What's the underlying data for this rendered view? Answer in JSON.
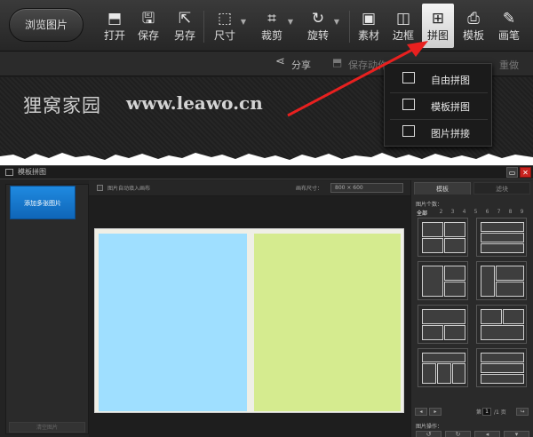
{
  "toolbar": {
    "browse_label": "浏览图片",
    "buttons": [
      {
        "label": "打开",
        "icon": "open-icon"
      },
      {
        "label": "保存",
        "icon": "save-icon"
      },
      {
        "label": "另存",
        "icon": "save-as-icon"
      },
      {
        "label": "尺寸",
        "icon": "resize-icon"
      },
      {
        "label": "裁剪",
        "icon": "crop-icon"
      },
      {
        "label": "旋转",
        "icon": "rotate-icon"
      },
      {
        "label": "素材",
        "icon": "material-icon"
      },
      {
        "label": "边框",
        "icon": "frame-icon"
      },
      {
        "label": "拼图",
        "icon": "collage-icon"
      },
      {
        "label": "模板",
        "icon": "template-icon"
      },
      {
        "label": "画笔",
        "icon": "brush-icon"
      }
    ],
    "active": "拼图"
  },
  "row2": {
    "share": "分享",
    "save_action": "保存动作",
    "redo": "重做"
  },
  "watermark": {
    "cn": "狸窝家园",
    "url": "www.leawo.cn"
  },
  "dropdown": {
    "items": [
      "自由拼图",
      "模板拼图",
      "图片拼接"
    ]
  },
  "window": {
    "title": "模板拼图",
    "add_button": "添加多张图片",
    "clear_button": "清空图片",
    "auto_fill_label": "图片自动填入画布",
    "canvas_size_label": "画布尺寸：",
    "canvas_size_value": "800 × 600",
    "tabs": [
      "模板",
      "滤块"
    ],
    "pic_count_label": "图片个数：",
    "count_all": "全部",
    "counts": [
      "2",
      "3",
      "4",
      "5",
      "6",
      "7",
      "8",
      "9"
    ],
    "page_prefix": "第",
    "page_current": "1",
    "page_total": "/1 页",
    "pic_ops_label": "图片操作："
  },
  "colors": {
    "cell_left": "#9fdfff",
    "cell_right": "#d5eb8f",
    "accent_blue": "#1f8ae0",
    "arrow_red": "#e8201f"
  }
}
